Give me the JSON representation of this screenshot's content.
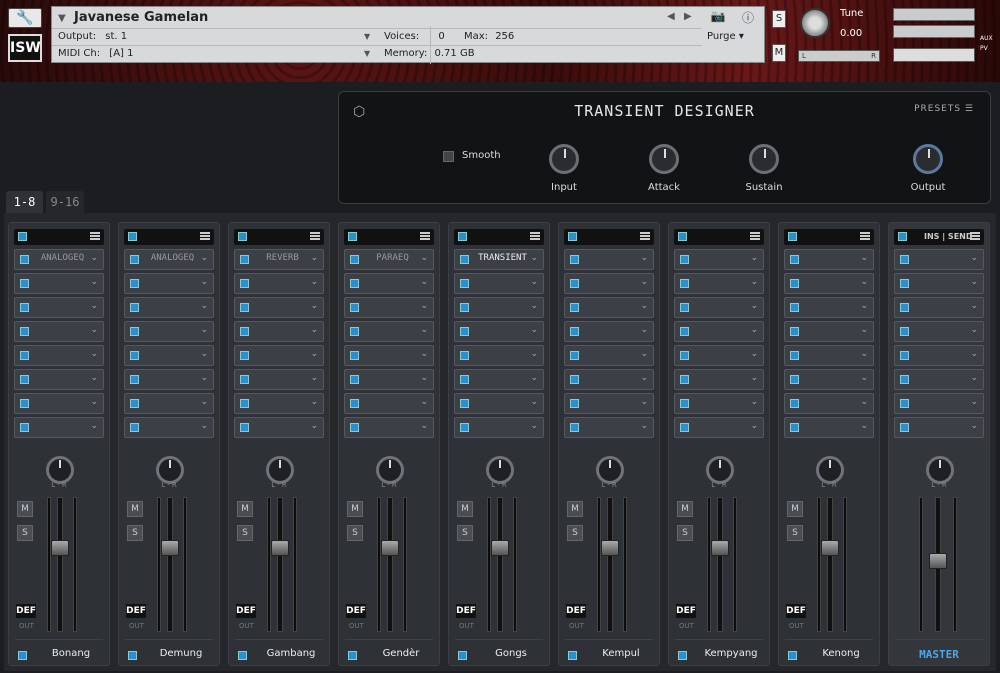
{
  "header": {
    "instrument_name": "Javanese Gamelan",
    "output_label": "Output:",
    "output_value": "st. 1",
    "midi_label": "MIDI Ch:",
    "midi_value": "[A]  1",
    "voices_label": "Voices:",
    "voices_value": "0",
    "max_label": "Max:",
    "max_value": "256",
    "memory_label": "Memory:",
    "memory_value": "0.71 GB",
    "purge_label": "Purge",
    "logo": "ISW",
    "s_label": "S",
    "m_label": "M",
    "tune_label": "Tune",
    "tune_value": "0.00",
    "pan_l": "L",
    "pan_r": "R",
    "aux_label": "AUX",
    "pv_label": "PV"
  },
  "plugin": {
    "title": "TRANSIENT DESIGNER",
    "presets_label": "PRESETS",
    "smooth_label": "Smooth",
    "knobs": [
      "Input",
      "Attack",
      "Sustain",
      "Output"
    ]
  },
  "tabs": [
    "1-8",
    "9-16"
  ],
  "strip_common": {
    "mute": "M",
    "solo": "S",
    "def": "DEF",
    "out": "OUT",
    "l": "L",
    "r": "R",
    "ins_send": "INS | SEND"
  },
  "channels": [
    {
      "name": "Bonang",
      "insert": "ANALOGEQ"
    },
    {
      "name": "Demung",
      "insert": "ANALOGEQ"
    },
    {
      "name": "Gambang",
      "insert": "REVERB"
    },
    {
      "name": "Gendèr",
      "insert": "PARAEQ"
    },
    {
      "name": "Gongs",
      "insert": "TRANSIENT"
    },
    {
      "name": "Kempul",
      "insert": ""
    },
    {
      "name": "Kempyang",
      "insert": ""
    },
    {
      "name": "Kenong",
      "insert": ""
    },
    {
      "name": "MASTER",
      "insert": ""
    }
  ],
  "colors": {
    "accent": "#2a8ed0",
    "master_label": "#4aa8e8",
    "header_bg": "#5a1414"
  }
}
